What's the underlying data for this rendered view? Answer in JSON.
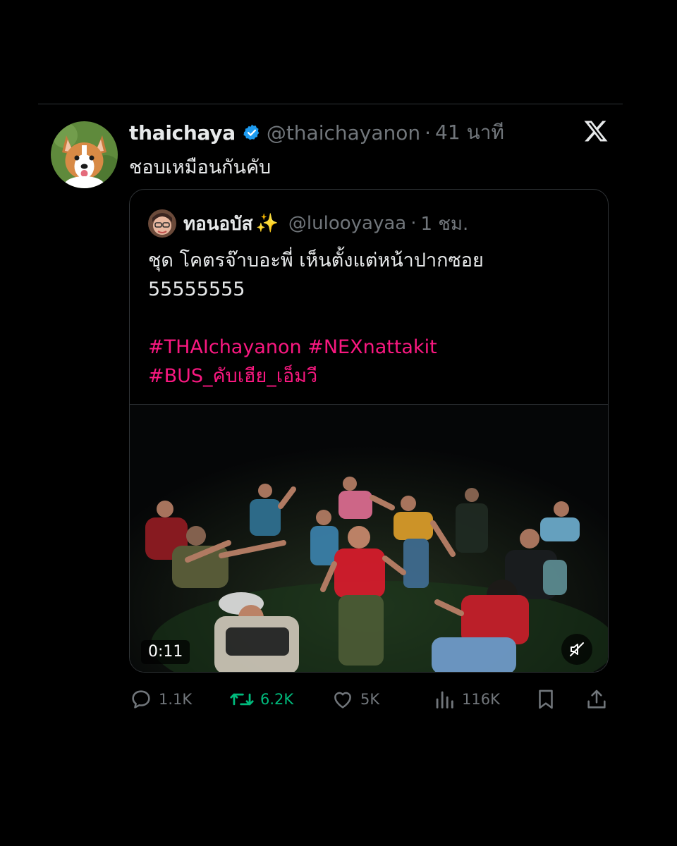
{
  "tweet": {
    "author": {
      "display_name": "thaichaya",
      "handle": "@thaichayanon",
      "verified": true,
      "avatar_icon": "corgi-avatar"
    },
    "separator": "·",
    "time": "41 นาที",
    "text": "ชอบเหมือนกันคับ",
    "platform_icon": "x-logo-icon"
  },
  "quote": {
    "author": {
      "display_name": "ทอนอบัส",
      "emoji": "✨",
      "handle": "@lulooyayaa",
      "avatar_icon": "person-avatar"
    },
    "separator": "·",
    "time": "1 ชม.",
    "text_line1": "ชุด โคตรจ๊าบอะพี่ เห็นตั้งแต่หน้าปากซอย",
    "text_line2": "55555555",
    "hashtags_line1": "#THAIchayanon #NEXnattakit",
    "hashtags_line2": "#BUS_คับเฮีย_เอ็มวี",
    "video": {
      "duration": "0:11",
      "muted_icon": "speaker-muted-icon"
    }
  },
  "actions": {
    "replies": "1.1K",
    "retweets": "6.2K",
    "likes": "5K",
    "views": "116K"
  },
  "colors": {
    "background": "#000000",
    "text": "#e7e9ea",
    "muted": "#71767b",
    "hashtag": "#f91880",
    "retweet": "#00ba7c",
    "verified": "#1d9bf0",
    "border": "#2f3336"
  }
}
